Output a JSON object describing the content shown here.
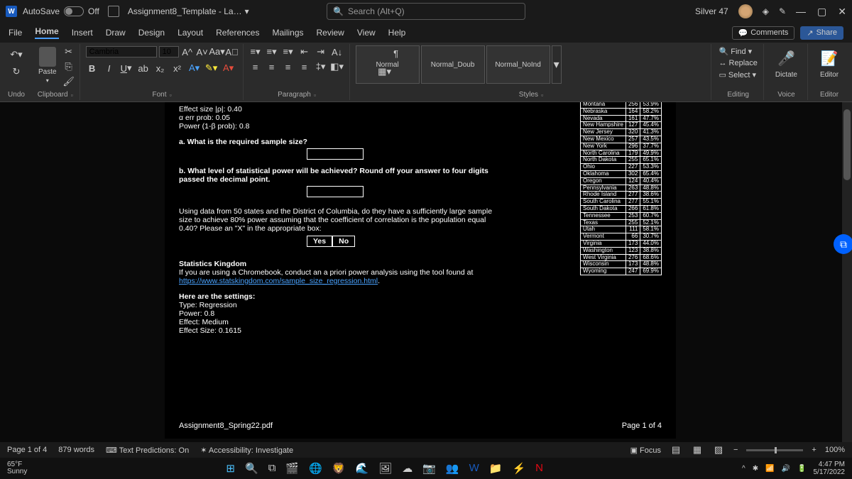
{
  "titlebar": {
    "autosave_label": "AutoSave",
    "autosave_state": "Off",
    "doc_title": "Assignment8_Template - La…",
    "search_placeholder": "Search (Alt+Q)",
    "user": "Silver 47"
  },
  "tabs": {
    "items": [
      "File",
      "Home",
      "Insert",
      "Draw",
      "Design",
      "Layout",
      "References",
      "Mailings",
      "Review",
      "View",
      "Help"
    ],
    "active": "Home",
    "comments": "Comments",
    "share": "Share"
  },
  "ribbon": {
    "undo": "Undo",
    "clipboard": "Clipboard",
    "paste": "Paste",
    "font": "Font",
    "font_name": "Cambria",
    "font_size": "10",
    "paragraph": "Paragraph",
    "styles": "Styles",
    "style_cards": [
      "Normal",
      "Normal_Doub",
      "Normal_NoInd"
    ],
    "editing": "Editing",
    "find": "Find",
    "replace": "Replace",
    "select": "Select",
    "dictate": "Dictate",
    "voice": "Voice",
    "editor": "Editor",
    "editor2": "Editor"
  },
  "document": {
    "lines": {
      "effect": "Effect size |ρ|: 0.40",
      "alpha": "α err prob: 0.05",
      "power": "Power (1-β prob): 0.8",
      "qa": "a. What is the required sample size?",
      "qb": "b. What level of statistical power will be achieved? Round off your answer to four digits passed the decimal point.",
      "para": "Using data from 50 states and the District of Columbia, do they have a sufficiently large sample size to achieve 80% power assuming that the coefficient of correlation is the population equal 0.40? Please an \"X\" in the appropriate box:",
      "yes": "Yes",
      "no": "No",
      "stitle": "Statistics Kingdom",
      "sline": "If you are using a Chromebook, conduct an a priori power analysis using the tool found at ",
      "slink": "https://www.statskingdom.com/sample_size_regression.html",
      "settings": "Here are the settings:",
      "s1": "Type: Regression",
      "s2": "Power: 0.8",
      "s3": "Effect: Medium",
      "s4": "Effect Size: 0.1615",
      "pdf": "Assignment8_Spring22.pdf",
      "pageno": "Page 1 of 4"
    },
    "table": [
      [
        "Montana",
        "256",
        "53.9%"
      ],
      [
        "Nebraska",
        "164",
        "58.2%"
      ],
      [
        "Nevada",
        "161",
        "47.7%"
      ],
      [
        "New Hampshire",
        "127",
        "45.4%"
      ],
      [
        "New Jersey",
        "320",
        "41.3%"
      ],
      [
        "New Mexico",
        "257",
        "43.5%"
      ],
      [
        "New York",
        "296",
        "37.7%"
      ],
      [
        "North Carolina",
        "179",
        "49.9%"
      ],
      [
        "North Dakota",
        "255",
        "65.1%"
      ],
      [
        "Ohio",
        "227",
        "53.3%"
      ],
      [
        "Oklahoma",
        "302",
        "65.4%"
      ],
      [
        "Oregon",
        "124",
        "40.4%"
      ],
      [
        "Pennsylvania",
        "263",
        "48.8%"
      ],
      [
        "Rhode Island",
        "277",
        "38.6%"
      ],
      [
        "South Carolina",
        "277",
        "55.1%"
      ],
      [
        "South Dakota",
        "266",
        "61.8%"
      ],
      [
        "Tennessee",
        "253",
        "60.7%"
      ],
      [
        "Texas",
        "255",
        "52.1%"
      ],
      [
        "Utah",
        "111",
        "58.1%"
      ],
      [
        "Vermont",
        "66",
        "30.7%"
      ],
      [
        "Virginia",
        "173",
        "44.0%"
      ],
      [
        "Washington",
        "123",
        "38.8%"
      ],
      [
        "West Virginia",
        "276",
        "68.6%"
      ],
      [
        "Wisconsin",
        "173",
        "48.8%"
      ],
      [
        "Wyoming",
        "247",
        "69.9%"
      ]
    ]
  },
  "status": {
    "page": "Page 1 of 4",
    "words": "879 words",
    "predictions": "Text Predictions: On",
    "accessibility": "Accessibility: Investigate",
    "focus": "Focus",
    "zoom": "100%"
  },
  "taskbar": {
    "temp": "65°F",
    "cond": "Sunny",
    "time": "4:47 PM",
    "date": "5/17/2022"
  }
}
